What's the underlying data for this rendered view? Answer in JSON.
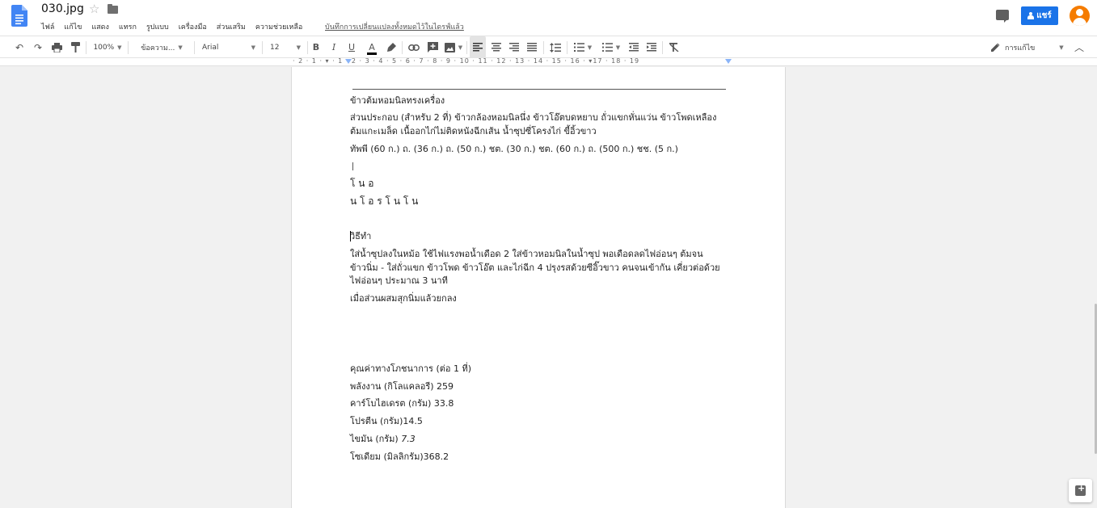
{
  "header": {
    "title": "030.jpg",
    "menu": [
      "ไฟล์",
      "แก้ไข",
      "แสดง",
      "แทรก",
      "รูปแบบ",
      "เครื่องมือ",
      "ส่วนเสริม",
      "ความช่วยเหลือ"
    ],
    "save_status": "บันทึกการเปลี่ยนแปลงทั้งหมดไว้ในไดรฟ์แล้ว",
    "share_label": "แชร์",
    "icons": [
      "docs-icon",
      "star-icon",
      "folder-icon",
      "comment-icon",
      "avatar"
    ]
  },
  "toolbar": {
    "zoom": "100%",
    "style": "ข้อความ...",
    "font": "Arial",
    "font_size": "12",
    "bold": "B",
    "italic": "I",
    "underline": "U",
    "text_color": "A",
    "editing_mode": "การแก้ไข",
    "icons": [
      "undo-icon",
      "redo-icon",
      "print-icon",
      "paint-format-icon",
      "highlight-icon",
      "link-icon",
      "add-comment-icon",
      "image-icon",
      "align-left-icon",
      "align-center-icon",
      "align-right-icon",
      "justify-icon",
      "line-spacing-icon",
      "numbered-list-icon",
      "bulleted-list-icon",
      "decrease-indent-icon",
      "increase-indent-icon",
      "clear-formatting-icon",
      "pencil-icon",
      "collapse-icon"
    ]
  },
  "ruler": {
    "marks": "· 2 · 1 · ▾ · 1 · 2 · 3 · 4 · 5 · 6 · 7 · 8 · 9 · 10 · 11 · 12 · 13 · 14 · 15 · 16 · ▾17 · 18 · 19"
  },
  "document": {
    "title": "ข้าวต้มหอมนิลทรงเครื่อง",
    "ingredients_1": "ส่วนประกอบ (สำหรับ 2 ที่) ข้าวกล้องหอมนิลนึ่ง ข้าวโอ๊ตบดหยาบ ถั่วแขกหั่นแว่น ข้าวโพดเหลือง",
    "ingredients_2": "ต้มแกะเมล็ด เนื้ออกไก่ไม่ติดหนังฉีกเส้น น้ำซุปซี่โครงไก่ ขี้อิ้วขาว",
    "ingredients_3": "ทัพพี (60 ก.) ถ. (36 ก.) ถ. (50 ก.) ชต. (30 ก.) ชต. (60 ก.) ถ. (500 ก.) ชช. (5 ก.)",
    "garbled_1": "โ น อ",
    "garbled_2": "น โ อ ร โ น โ น",
    "method_title": "วิธีทำ",
    "method_1": "ใส่น้ำซุปลงในหม้อ ใช้ไฟแรงพอน้ำเดือด 2 ใส่ข้าวหอมนิลในน้ำซุป พอเดือดลดไฟอ่อนๆ ต้มจน",
    "method_2": "ข้าวนิ่ม - ใส่ถั่วแขก ข้าวโพด ข้าวโอ๊ต และไก่ฉีก 4 ปรุงรสด้วยซีอิ๊วขาว คนจนเข้ากัน เคี่ยวต่อด้วย",
    "method_3": "ไฟอ่อนๆ ประมาณ 3 นาที",
    "method_4": "เมื่อส่วนผสมสุกนิ่มแล้วยกลง",
    "nutrition_title": "คุณค่าทางโภชนาการ (ต่อ 1 ที่)",
    "nutrition_energy": "พลังงาน (กิโลแคลอรี) 259",
    "nutrition_carb": "คาร์โบไฮเดรต (กรัม) 33.8",
    "nutrition_protein": "โปรตีน (กรัม)14.5",
    "nutrition_fat_label": "ไขมัน (กรัม) ",
    "nutrition_fat_value": "7.3",
    "nutrition_sodium": "โซเดียม (มิลลิกรัม)368.2"
  }
}
